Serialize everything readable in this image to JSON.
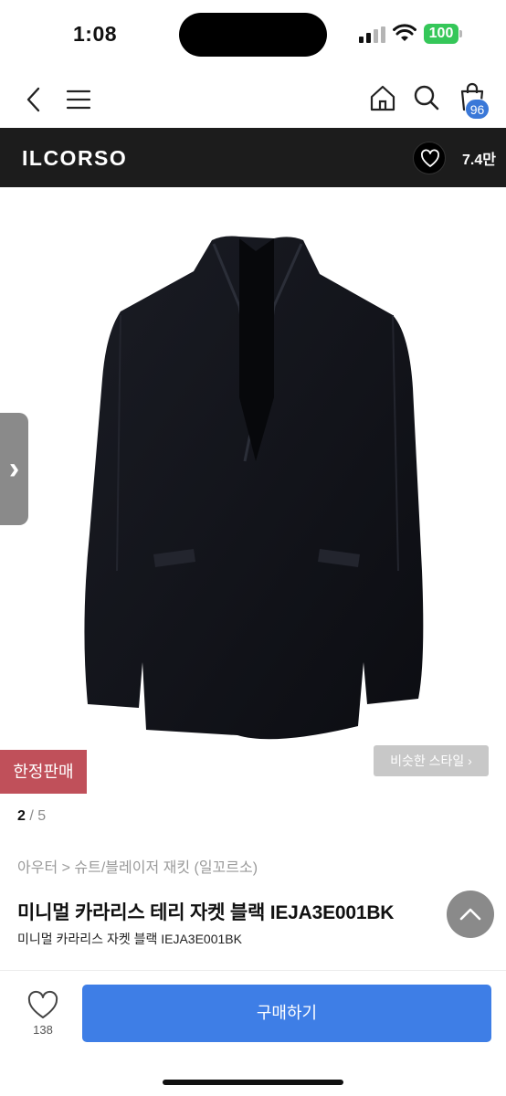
{
  "status_bar": {
    "time": "1:08",
    "battery": "100",
    "battery_color": "#35c759"
  },
  "topnav": {
    "icons": [
      "back-chevron-icon",
      "menu-icon",
      "home-icon",
      "search-icon",
      "shopping-bag-icon"
    ],
    "cart_count": "96"
  },
  "brand": {
    "name": "ILCORSO",
    "like_count": "7.4만",
    "bar_color": "#1c1c1c"
  },
  "hero": {
    "next_arrow": "›",
    "limited_badge": "한정판매",
    "similar_style": "비슷한 스타일 ›",
    "image_subject": "black-blazer-jacket"
  },
  "pager": {
    "current": "2",
    "separator": " / ",
    "total": "5"
  },
  "product": {
    "breadcrumb": "아우터 > 슈트/블레이저 재킷 (일꼬르소)",
    "title": "미니멀 카라리스 테리 자켓 블랙 IEJA3E001BK",
    "subtitle": "미니멀 카라리스 자켓 블랙 IEJA3E001BK"
  },
  "bottom_bar": {
    "like_count": "138",
    "buy_label": "구매하기",
    "buy_color": "#3e7ee6"
  }
}
